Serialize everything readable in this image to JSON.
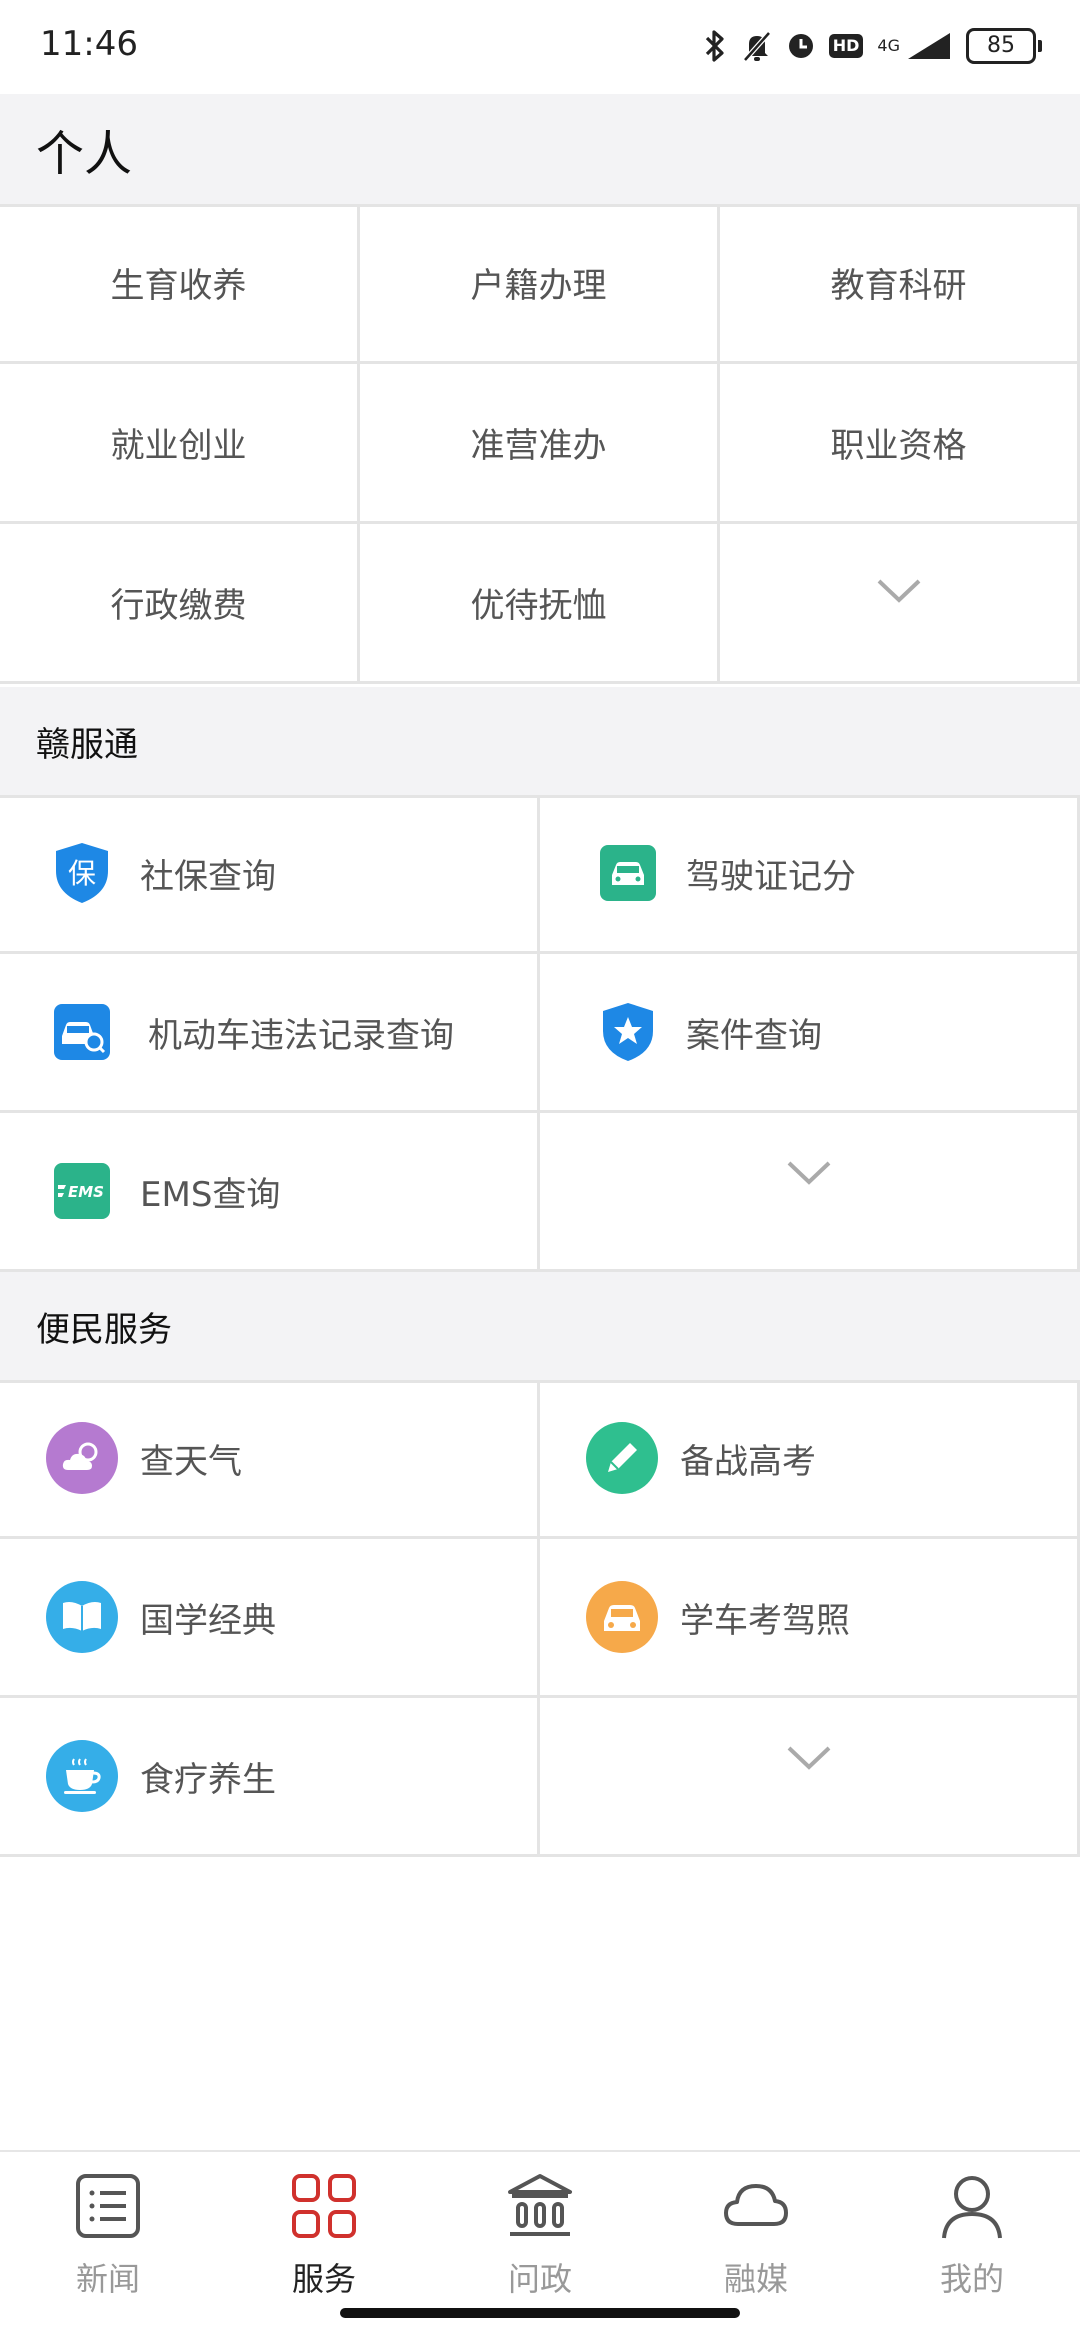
{
  "status_bar": {
    "time": "11:46",
    "battery": "85",
    "hd": "HD",
    "network": "4G",
    "icons": [
      "bluetooth-icon",
      "mute-icon",
      "alarm-icon",
      "hd-icon",
      "signal-icon",
      "battery-icon"
    ]
  },
  "personal": {
    "title": "个人",
    "items": [
      {
        "label": "生育收养"
      },
      {
        "label": "户籍办理"
      },
      {
        "label": "教育科研"
      },
      {
        "label": "就业创业"
      },
      {
        "label": "准营准办"
      },
      {
        "label": "职业资格"
      },
      {
        "label": "行政缴费"
      },
      {
        "label": "优待抚恤"
      }
    ],
    "expand_icon": "chevron-down-icon"
  },
  "ganfutong": {
    "title": "赣服通",
    "items": [
      {
        "label": "社保查询",
        "icon": "social-security-icon",
        "icon_text": "保",
        "color": "#1e88e5"
      },
      {
        "label": "驾驶证记分",
        "icon": "driver-license-car-icon",
        "color": "#2bb38a"
      },
      {
        "label": "机动车违法记录查询",
        "icon": "vehicle-search-icon",
        "color": "#1e88e5"
      },
      {
        "label": "案件查询",
        "icon": "police-shield-icon",
        "color": "#1e88e5"
      },
      {
        "label": "EMS查询",
        "icon": "ems-icon",
        "icon_text": "EMS",
        "color": "#2bb38a"
      }
    ],
    "expand_icon": "chevron-down-icon"
  },
  "convenience": {
    "title": "便民服务",
    "items": [
      {
        "label": "查天气",
        "icon": "weather-icon",
        "color": "#b57ad0"
      },
      {
        "label": "备战高考",
        "icon": "pencil-icon",
        "color": "#2fbf8f"
      },
      {
        "label": "国学经典",
        "icon": "book-icon",
        "color": "#35aee8"
      },
      {
        "label": "学车考驾照",
        "icon": "car-icon",
        "color": "#f6a94a"
      },
      {
        "label": "食疗养生",
        "icon": "tea-cup-icon",
        "color": "#35aee8"
      }
    ],
    "expand_icon": "chevron-down-icon"
  },
  "bottom_nav": {
    "active_color": "#d0312d",
    "items": [
      {
        "label": "新闻",
        "icon": "news-list-icon"
      },
      {
        "label": "服务",
        "icon": "services-grid-icon",
        "active": true
      },
      {
        "label": "问政",
        "icon": "government-building-icon"
      },
      {
        "label": "融媒",
        "icon": "cloud-icon"
      },
      {
        "label": "我的",
        "icon": "user-profile-icon"
      }
    ]
  }
}
